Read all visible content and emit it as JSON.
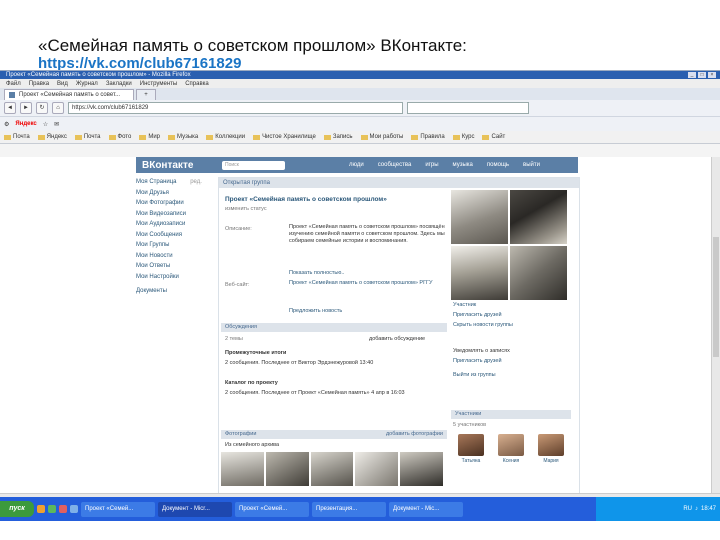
{
  "slide": {
    "title": "«Семейная память о советском прошлом» ВКонтакте:",
    "link": "https://vk.com/club67161829"
  },
  "browser": {
    "window_title": "Проект «Семейная память о советском прошлом» - Mozilla Firefox",
    "menu": [
      "Файл",
      "Правка",
      "Вид",
      "Журнал",
      "Закладки",
      "Инструменты",
      "Справка"
    ],
    "tab_label": "Проект «Семейная память о совет...",
    "url": "https://vk.com/club67161829",
    "yandex_label": "Яндекс",
    "bookmarks": [
      "Почта",
      "Яндекс",
      "Почта",
      "Фото",
      "Мир",
      "Музыка",
      "Коллекции",
      "Чистое Хранилище",
      "Запись",
      "Мои работы",
      "Правила",
      "Курс",
      "Сайт"
    ]
  },
  "vk": {
    "logo": "ВКонтакте",
    "search_placeholder": "Поиск",
    "nav": [
      "люди",
      "сообщества",
      "игры",
      "музыка",
      "помощь",
      "выйти"
    ],
    "left_menu": [
      "Моя Страница",
      "Мои Друзья",
      "Мои Фотографии",
      "Мои Видеозаписи",
      "Мои Аудиозаписи",
      "Мои Сообщения",
      "Мои Группы",
      "Мои Новости",
      "Мои Ответы",
      "Мои Настройки",
      "Документы"
    ],
    "edit_label": "ред.",
    "group_type": "Открытая группа",
    "group_name": "Проект «Семейная память о советском прошлом»",
    "group_status": "изменить статус",
    "description_label": "Описание:",
    "description_text": "Проект «Семейная память о советском прошлом» посвящён изучению семейной памяти о советском прошлом. Здесь мы собираем семейные истории и воспоминания.",
    "show_more": "Показать полностью..",
    "website_label": "Веб-сайт:",
    "website_text": "Проект «Семейная память о советском прошлом» РГГУ",
    "suggest_news": "Предложить новость",
    "right_links": [
      "Участник",
      "Пригласить друзей",
      "Скрыть новости группы"
    ],
    "right_block": [
      "Уведомлять о записях",
      "Пригласить друзей",
      "Выйти из группы"
    ],
    "discussions_title": "Обсуждения",
    "discussions_count": "2 темы",
    "discussions_action": "добавить обсуждение",
    "topics": [
      {
        "title": "Промежуточные итоги",
        "meta": "2 сообщения. Последнее от Виктор Эрдэнежуровой 13:40"
      },
      {
        "title": "Каталог по проекту",
        "meta": "2 сообщения. Последнее от Проект «Семейная память» 4 апр в 16:03"
      }
    ],
    "members_title": "Участники",
    "members_count": "5 участников",
    "members": [
      "Татьяна",
      "Ксения",
      "Мария"
    ],
    "photos_title": "Фотографии",
    "photos_action": "добавить фотографии",
    "photo_album": "Из семейного архива"
  },
  "taskbar": {
    "start": "пуск",
    "tasks": [
      "Проект «Семей...",
      "Документ - Micr...",
      "Проект «Семей...",
      "Презентация...",
      "Документ - Mic..."
    ],
    "clock": "18:47",
    "lang": "RU"
  },
  "colors": {
    "vk_blue": "#5b7fa6",
    "link_blue": "#1a74c5",
    "taskbar": "#245edb",
    "start_green": "#3c9a3c"
  }
}
